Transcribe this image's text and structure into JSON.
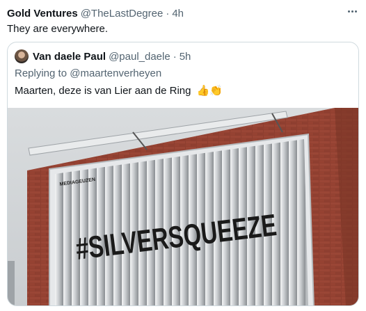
{
  "tweet": {
    "author_name": "Gold Ventures",
    "author_handle": "@TheLastDegree",
    "separator": "·",
    "time": "4h",
    "text": "They are everywhere.",
    "more_icon": "more-horizontal-icon"
  },
  "quoted_tweet": {
    "author_name": "Van daele Paul",
    "author_handle": "@paul_daele",
    "separator": "·",
    "time": "5h",
    "replying_prefix": "Replying to",
    "replying_to": "@maartenverheyen",
    "text": "Maarten, deze is van Lier aan de Ring",
    "emojis": [
      "👍",
      "👏"
    ]
  },
  "photo": {
    "billboard_brand": "MEDIAGEUZEN",
    "billboard_text": "#SILVERSQUEEZE"
  }
}
